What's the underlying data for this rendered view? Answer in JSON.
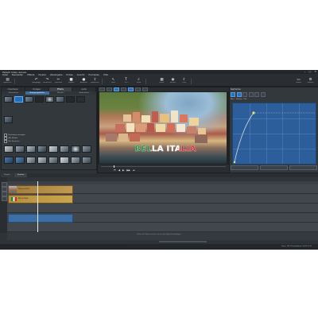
{
  "app": {
    "title": "MAGIX Video deluxe",
    "window_buttons": [
      "–",
      "□",
      "✕"
    ]
  },
  "menu": [
    "Datei",
    "Bearbeiten",
    "Effekte",
    "Fenster",
    "Wiedergabe",
    "Extras",
    "Ansicht",
    "Hochladen",
    "Hilfe"
  ],
  "toolbar": [
    {
      "icon": "folder-icon",
      "glyph": "▤",
      "label": "Importieren"
    },
    {
      "icon": "undo-icon",
      "glyph": "↶",
      "label": "Rückgängig"
    },
    {
      "icon": "redo-icon",
      "glyph": "↷",
      "label": "Wiederherstellen"
    },
    {
      "icon": "cut-icon",
      "glyph": "✂",
      "label": "Schneiden"
    },
    {
      "icon": "stop-icon",
      "glyph": "■",
      "label": "Stoppen"
    },
    {
      "icon": "record-icon",
      "glyph": "●",
      "label": "Aufnahme"
    },
    {
      "icon": "export-icon",
      "glyph": "⇪",
      "label": "Exportieren"
    },
    {
      "icon": "mouse-icon",
      "glyph": "↖",
      "label": "Maus"
    },
    {
      "icon": "text-icon",
      "glyph": "T",
      "label": "Titel"
    },
    {
      "icon": "magnify-icon",
      "glyph": "⌕",
      "label": "Zoom"
    },
    {
      "icon": "film-icon",
      "glyph": "▦",
      "label": "Effekte"
    },
    {
      "icon": "disc-icon",
      "glyph": "◉",
      "label": "Brennen"
    },
    {
      "icon": "share-icon",
      "glyph": "⇧",
      "label": "Teilen"
    },
    {
      "icon": "screen-icon",
      "glyph": "▭",
      "label": "Vollbild"
    },
    {
      "icon": "settings-icon",
      "glyph": "⚙",
      "label": "Optionen"
    }
  ],
  "pool": {
    "tabs": [
      "Importieren",
      "Vorlagen",
      "Effekte",
      "Audio"
    ],
    "active_tab": 2,
    "subtabs": [
      "Videoeffekte",
      "Bewegungseffekte",
      "Blenden",
      "Audioeffekte"
    ],
    "active_subtab": 1,
    "checks": [
      "Keyframes anzeigen",
      "Alle Effekte",
      "Nur Favoriten"
    ]
  },
  "player": {
    "overlay_text": "BELLA ITALIA"
  },
  "properties": {
    "title": "Keyframes",
    "graph_header": [
      "Wert",
      "Position",
      "Zeit"
    ]
  },
  "timeline": {
    "tabs": [
      "Projekt",
      "Timeline"
    ],
    "active_tab": 1,
    "clips": [
      {
        "type": "video",
        "name": "Manarola.MOV"
      },
      {
        "type": "title",
        "name": "BELLA ITALIA"
      },
      {
        "type": "blue",
        "name": ""
      }
    ],
    "drop_text": "Ziehen Sie Dateien hierher, um sie dem Projekt hinzuzufügen"
  },
  "status": {
    "right": "Zoom: 100 %    Projektdauer: 00:00:12:15"
  },
  "colors": {
    "panel": "#33383d",
    "accent": "#2d6fb6",
    "clip_video": "#c09a52",
    "clip_title": "#c9a54f"
  }
}
